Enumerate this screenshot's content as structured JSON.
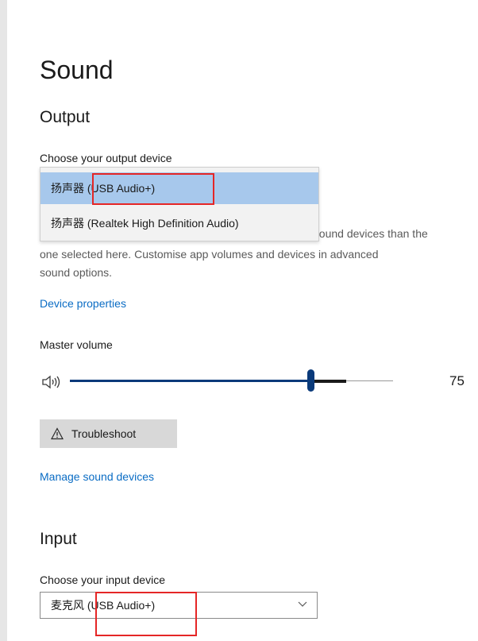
{
  "page": {
    "title": "Sound"
  },
  "output": {
    "section_title": "Output",
    "choose_label": "Choose your output device",
    "options": [
      {
        "prefix": "扬声器",
        "label": " (USB Audio+)",
        "selected": true
      },
      {
        "prefix": "扬声器",
        "label": " (Realtek High Definition Audio)",
        "selected": false
      }
    ],
    "info_lines": [
      "t sound devices than the",
      "one selected here. Customise app volumes and devices in advanced",
      "sound options."
    ],
    "device_properties_link": "Device properties",
    "master_volume_label": "Master volume",
    "volume": 75,
    "volume_display": "75",
    "troubleshoot_label": "Troubleshoot",
    "manage_link": "Manage sound devices"
  },
  "input": {
    "section_title": "Input",
    "choose_label": "Choose your input device",
    "selected_prefix": "麦克风",
    "selected_label": " (USB Audio+)"
  },
  "colors": {
    "accent": "#0a6cc4",
    "selected_option": "#a7c8ec",
    "annotation": "#e52626"
  }
}
